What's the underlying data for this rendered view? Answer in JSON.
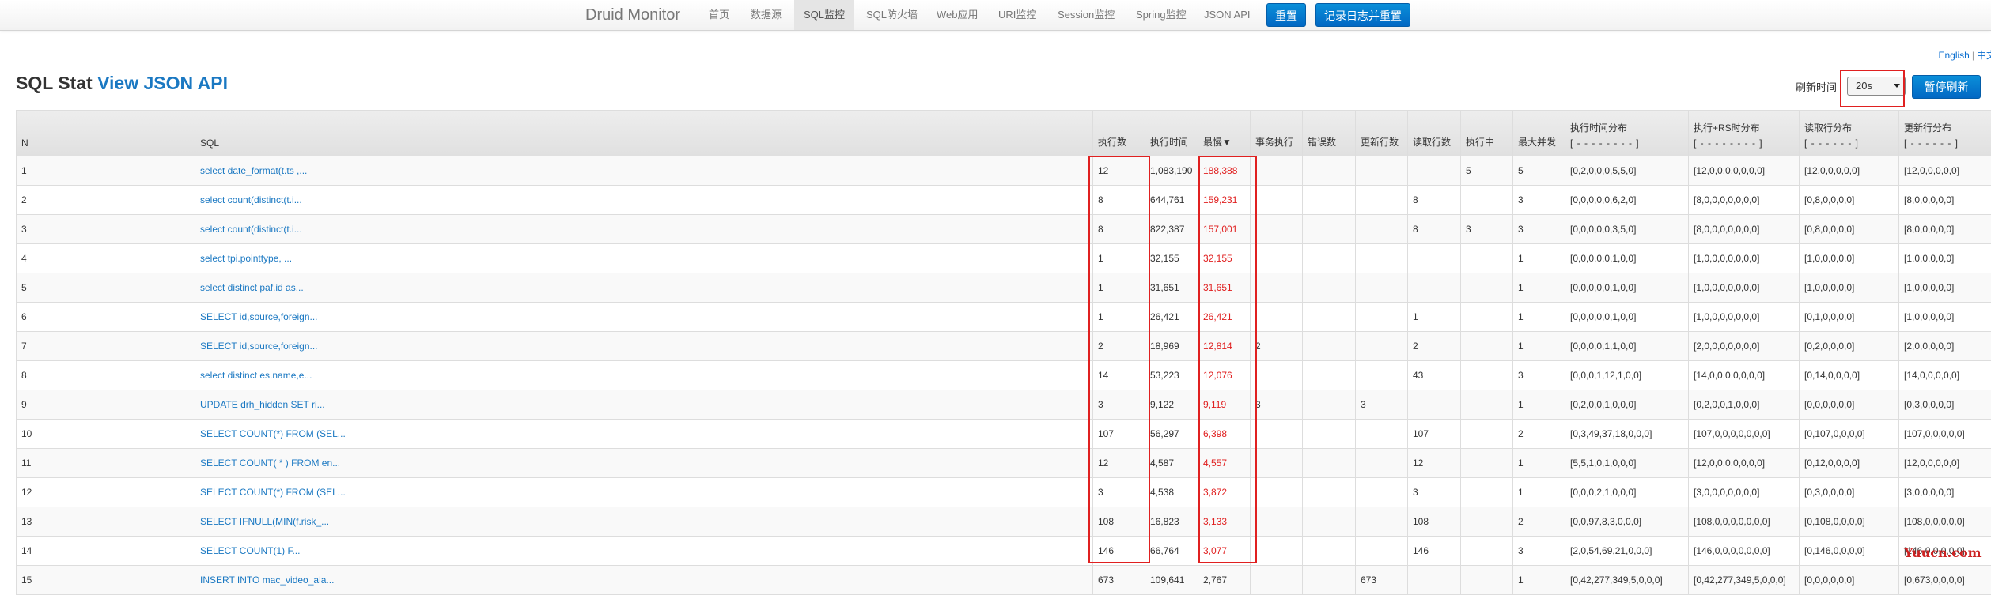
{
  "nav": {
    "brand": "Druid Monitor",
    "items": [
      {
        "label": "首页",
        "active": false
      },
      {
        "label": "数据源",
        "active": false
      },
      {
        "label": "SQL监控",
        "active": true
      },
      {
        "label": "SQL防火墙",
        "active": false
      },
      {
        "label": "Web应用",
        "active": false
      },
      {
        "label": "URI监控",
        "active": false
      },
      {
        "label": "Session监控",
        "active": false
      },
      {
        "label": "Spring监控",
        "active": false
      },
      {
        "label": "JSON API",
        "active": false
      }
    ],
    "reset_label": "重置",
    "reset_log_label": "记录日志并重置"
  },
  "lang": {
    "english": "English",
    "separator": "|",
    "chinese": "中文"
  },
  "header": {
    "title": "SQL Stat",
    "json_link": "View JSON API"
  },
  "refresh": {
    "label": "刷新时间",
    "selected": "20s",
    "pause_label": "暂停刷新"
  },
  "table": {
    "columns": [
      {
        "label": "N",
        "sub": ""
      },
      {
        "label": "SQL",
        "sub": ""
      },
      {
        "label": "执行数",
        "sub": ""
      },
      {
        "label": "执行时间",
        "sub": ""
      },
      {
        "label": "最慢▼",
        "sub": ""
      },
      {
        "label": "事务执行",
        "sub": ""
      },
      {
        "label": "错误数",
        "sub": ""
      },
      {
        "label": "更新行数",
        "sub": ""
      },
      {
        "label": "读取行数",
        "sub": ""
      },
      {
        "label": "执行中",
        "sub": ""
      },
      {
        "label": "最大并发",
        "sub": ""
      },
      {
        "label": "执行时间分布",
        "sub": "[ - - - - - - - - ]"
      },
      {
        "label": "执行+RS时分布",
        "sub": "[ - - - - - - - - ]"
      },
      {
        "label": "读取行分布",
        "sub": "[ - - - - - - ]"
      },
      {
        "label": "更新行分布",
        "sub": "[ - - - - - - ]"
      }
    ],
    "rows": [
      [
        "1",
        "select date_format(t.ts ,...",
        "12",
        "1,083,190",
        "188,388",
        "",
        "",
        "",
        "",
        "5",
        "5",
        "[0,2,0,0,0,5,5,0]",
        "[12,0,0,0,0,0,0,0]",
        "[12,0,0,0,0,0]",
        "[12,0,0,0,0,0]"
      ],
      [
        "2",
        "select count(distinct(t.i...",
        "8",
        "644,761",
        "159,231",
        "",
        "",
        "",
        "8",
        "",
        "3",
        "[0,0,0,0,0,6,2,0]",
        "[8,0,0,0,0,0,0,0]",
        "[0,8,0,0,0,0]",
        "[8,0,0,0,0,0]"
      ],
      [
        "3",
        "select count(distinct(t.i...",
        "8",
        "822,387",
        "157,001",
        "",
        "",
        "",
        "8",
        "3",
        "3",
        "[0,0,0,0,0,3,5,0]",
        "[8,0,0,0,0,0,0,0]",
        "[0,8,0,0,0,0]",
        "[8,0,0,0,0,0]"
      ],
      [
        "4",
        "select tpi.pointtype, ...",
        "1",
        "32,155",
        "32,155",
        "",
        "",
        "",
        "",
        "",
        "1",
        "[0,0,0,0,0,1,0,0]",
        "[1,0,0,0,0,0,0,0]",
        "[1,0,0,0,0,0]",
        "[1,0,0,0,0,0]"
      ],
      [
        "5",
        "select distinct paf.id as...",
        "1",
        "31,651",
        "31,651",
        "",
        "",
        "",
        "",
        "",
        "1",
        "[0,0,0,0,0,1,0,0]",
        "[1,0,0,0,0,0,0,0]",
        "[1,0,0,0,0,0]",
        "[1,0,0,0,0,0]"
      ],
      [
        "6",
        "SELECT id,source,foreign...",
        "1",
        "26,421",
        "26,421",
        "",
        "",
        "",
        "1",
        "",
        "1",
        "[0,0,0,0,0,1,0,0]",
        "[1,0,0,0,0,0,0,0]",
        "[0,1,0,0,0,0]",
        "[1,0,0,0,0,0]"
      ],
      [
        "7",
        "SELECT id,source,foreign...",
        "2",
        "18,969",
        "12,814",
        "2",
        "",
        "",
        "2",
        "",
        "1",
        "[0,0,0,0,1,1,0,0]",
        "[2,0,0,0,0,0,0,0]",
        "[0,2,0,0,0,0]",
        "[2,0,0,0,0,0]"
      ],
      [
        "8",
        "select distinct es.name,e...",
        "14",
        "53,223",
        "12,076",
        "",
        "",
        "",
        "43",
        "",
        "3",
        "[0,0,0,1,12,1,0,0]",
        "[14,0,0,0,0,0,0,0]",
        "[0,14,0,0,0,0]",
        "[14,0,0,0,0,0]"
      ],
      [
        "9",
        "UPDATE drh_hidden SET ri...",
        "3",
        "9,122",
        "9,119",
        "3",
        "",
        "3",
        "",
        "",
        "1",
        "[0,2,0,0,1,0,0,0]",
        "[0,2,0,0,1,0,0,0]",
        "[0,0,0,0,0,0]",
        "[0,3,0,0,0,0]"
      ],
      [
        "10",
        "SELECT COUNT(*) FROM (SEL...",
        "107",
        "56,297",
        "6,398",
        "",
        "",
        "",
        "107",
        "",
        "2",
        "[0,3,49,37,18,0,0,0]",
        "[107,0,0,0,0,0,0,0]",
        "[0,107,0,0,0,0]",
        "[107,0,0,0,0,0]"
      ],
      [
        "11",
        "SELECT COUNT( * ) FROM en...",
        "12",
        "4,587",
        "4,557",
        "",
        "",
        "",
        "12",
        "",
        "1",
        "[5,5,1,0,1,0,0,0]",
        "[12,0,0,0,0,0,0,0]",
        "[0,12,0,0,0,0]",
        "[12,0,0,0,0,0]"
      ],
      [
        "12",
        "SELECT COUNT(*) FROM (SEL...",
        "3",
        "4,538",
        "3,872",
        "",
        "",
        "",
        "3",
        "",
        "1",
        "[0,0,0,2,1,0,0,0]",
        "[3,0,0,0,0,0,0,0]",
        "[0,3,0,0,0,0]",
        "[3,0,0,0,0,0]"
      ],
      [
        "13",
        "SELECT IFNULL(MIN(f.risk_...",
        "108",
        "16,823",
        "3,133",
        "",
        "",
        "",
        "108",
        "",
        "2",
        "[0,0,97,8,3,0,0,0]",
        "[108,0,0,0,0,0,0,0]",
        "[0,108,0,0,0,0]",
        "[108,0,0,0,0,0]"
      ],
      [
        "14",
        "SELECT COUNT(1) F...",
        "146",
        "66,764",
        "3,077",
        "",
        "",
        "",
        "146",
        "",
        "3",
        "[2,0,54,69,21,0,0,0]",
        "[146,0,0,0,0,0,0,0]",
        "[0,146,0,0,0,0]",
        "[146,0,0,0,0,0]"
      ],
      [
        "15",
        "INSERT INTO mac_video_ala...",
        "673",
        "109,641",
        "2,767",
        "",
        "",
        "673",
        "",
        "",
        "1",
        "[0,42,277,349,5,0,0,0]",
        "[0,42,277,349,5,0,0,0]",
        "[0,0,0,0,0,0]",
        "[0,673,0,0,0,0]"
      ]
    ]
  },
  "watermark": "Yuucn.com",
  "colors": {
    "accent": "#1a78c2",
    "button": "#0268c4",
    "slow_value": "#e02020",
    "highlight": "#e02020"
  }
}
